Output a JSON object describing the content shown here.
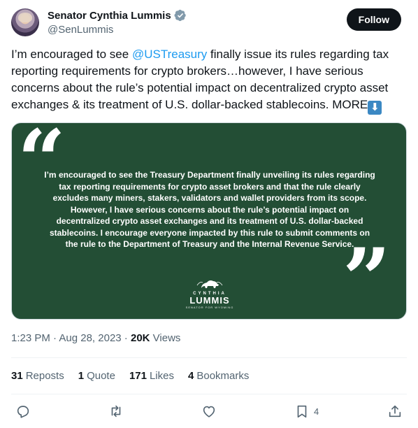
{
  "author": {
    "display_name": "Senator Cynthia Lummis",
    "handle": "@SenLummis",
    "verified_icon": "verified-badge-icon",
    "follow_label": "Follow"
  },
  "tweet": {
    "text_before_mention": "I’m encouraged to see ",
    "mention": "@USTreasury",
    "text_after_mention": " finally issue its rules regarding tax reporting requirements for crypto brokers…however, I have serious concerns about the rule’s potential impact on decentralized crypto asset exchanges & its treatment of U.S. dollar-backed stablecoins. MORE",
    "emoji": "⬇"
  },
  "media": {
    "background_color": "#234e35",
    "open_quote": "“",
    "close_quote": "”",
    "quote_text": "I’m encouraged to see the Treasury Department finally unveiling its rules regarding tax reporting requirements for crypto asset brokers and that the rule clearly excludes many miners, stakers, validators and wallet providers from its scope. However, I have serious concerns about the rule’s potential impact on decentralized crypto asset exchanges and its treatment of U.S. dollar-backed stablecoins. I encourage everyone impacted by this rule to submit comments on the rule to the Department of Treasury and the Internal Revenue Service.",
    "logo_first": "CYNTHIA",
    "logo_last": "LUMMIS",
    "logo_sub": "SENATOR FOR WYOMING"
  },
  "meta": {
    "time": "1:23 PM",
    "sep1": " · ",
    "date": "Aug 28, 2023",
    "sep2": " · ",
    "views_count": "20K",
    "views_label": " Views"
  },
  "stats": {
    "reposts_count": "31",
    "reposts_label": "Reposts",
    "quotes_count": "1",
    "quotes_label": "Quote",
    "likes_count": "171",
    "likes_label": "Likes",
    "bookmarks_count": "4",
    "bookmarks_label": "Bookmarks"
  },
  "actions": {
    "reply_icon": "reply-icon",
    "repost_icon": "repost-icon",
    "like_icon": "heart-icon",
    "bookmark_icon": "bookmark-icon",
    "bookmark_count": "4",
    "share_icon": "share-icon"
  },
  "colors": {
    "link": "#1d9bf0",
    "text": "#0f1419",
    "secondary": "#536471",
    "verified": "#829aab"
  }
}
